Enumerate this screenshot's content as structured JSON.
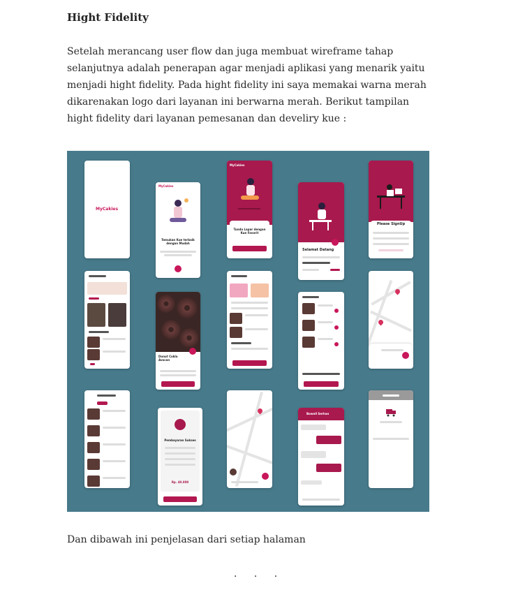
{
  "article": {
    "heading": "Hight Fidelity",
    "paragraph": "Setelah merancang user flow dan juga membuat wireframe tahap selanjutnya adalah penerapan agar menjadi aplikasi yang menarik yaitu menjadi hight fidelity. Pada hight fidelity ini saya memakai warna merah dikarenakan logo dari layanan ini berwarna merah. Berikut tampilan hight fidelity dari layanan pemesanan dan develiry kue :",
    "caption": "Dan dibawah ini penjelasan dari setiap halaman",
    "separator": "· · ·"
  },
  "mockups": {
    "logo": "MyCakies",
    "onboarding_title": "Temukan Kue terbaik dengan Mudah",
    "onboarding2_title": "Tunda Lapar dengan Kue Favorit",
    "welcome_title": "Selamat Datang",
    "signup_title": "Please SignUp",
    "detail_title": "Donut Cokla Avocan",
    "payment_title": "Pembayaran Sukses",
    "payment_amount": "Rp. 40.000",
    "chat_name": "Bowell Serhan"
  },
  "colors": {
    "brand": "#a8194d",
    "backdrop": "#477a8b"
  }
}
